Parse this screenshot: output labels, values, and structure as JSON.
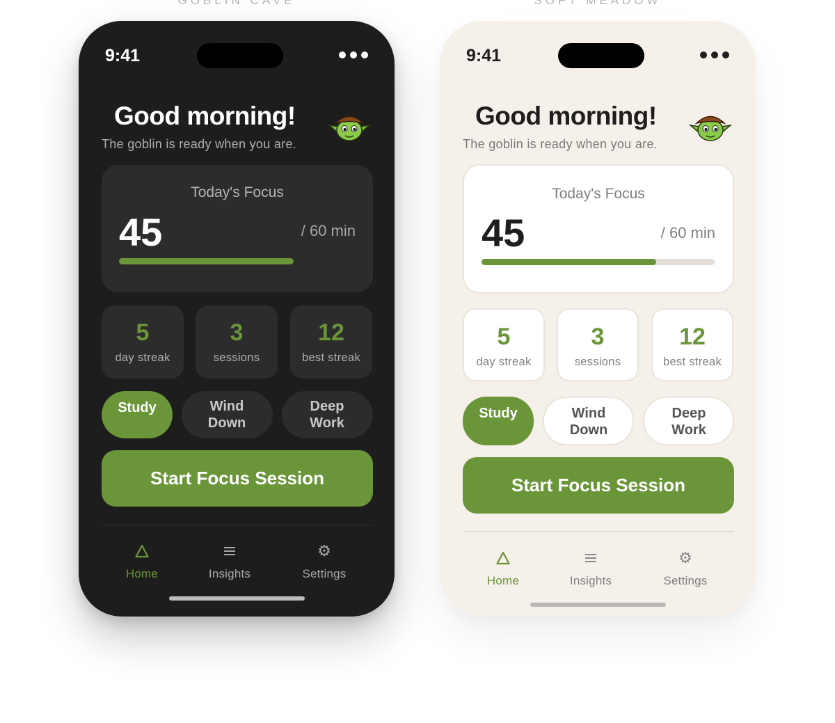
{
  "themes": [
    {
      "label": "GOBLIN CAVE",
      "status": {
        "time": "9:41"
      },
      "greeting": "Good morning!",
      "subtitle": "The goblin is ready when you are.",
      "focus": {
        "title": "Today's Focus",
        "value": "45",
        "goal": "/ 60 min",
        "progress": 0.75
      },
      "stats": [
        {
          "value": "5",
          "label": "day streak"
        },
        {
          "value": "3",
          "label": "sessions"
        },
        {
          "value": "12",
          "label": "best streak"
        }
      ],
      "modes": [
        {
          "label": "Study",
          "selected": true
        },
        {
          "label": "Wind Down",
          "selected": false
        },
        {
          "label": "Deep Work",
          "selected": false
        }
      ],
      "start_button": "Start Focus Session",
      "nav": [
        {
          "label": "Home",
          "icon": "home-triangle-icon",
          "active": true
        },
        {
          "label": "Insights",
          "icon": "list-icon",
          "active": false
        },
        {
          "label": "Settings",
          "icon": "gear-icon",
          "active": false
        }
      ]
    },
    {
      "label": "SOFT MEADOW",
      "status": {
        "time": "9:41"
      },
      "greeting": "Good morning!",
      "subtitle": "The goblin is ready when you are.",
      "focus": {
        "title": "Today's Focus",
        "value": "45",
        "goal": "/ 60 min",
        "progress": 0.75
      },
      "stats": [
        {
          "value": "5",
          "label": "day streak"
        },
        {
          "value": "3",
          "label": "sessions"
        },
        {
          "value": "12",
          "label": "best streak"
        }
      ],
      "modes": [
        {
          "label": "Study",
          "selected": true
        },
        {
          "label": "Wind Down",
          "selected": false
        },
        {
          "label": "Deep Work",
          "selected": false
        }
      ],
      "start_button": "Start Focus Session",
      "nav": [
        {
          "label": "Home",
          "icon": "home-triangle-icon",
          "active": true
        },
        {
          "label": "Insights",
          "icon": "list-icon",
          "active": false
        },
        {
          "label": "Settings",
          "icon": "gear-icon",
          "active": false
        }
      ]
    }
  ],
  "colors": {
    "accent": "#6a9539",
    "dark_bg": "#1d1d1d",
    "dark_card": "#2c2c2c",
    "light_bg": "#f5f0e9",
    "light_card": "#ffffff"
  }
}
